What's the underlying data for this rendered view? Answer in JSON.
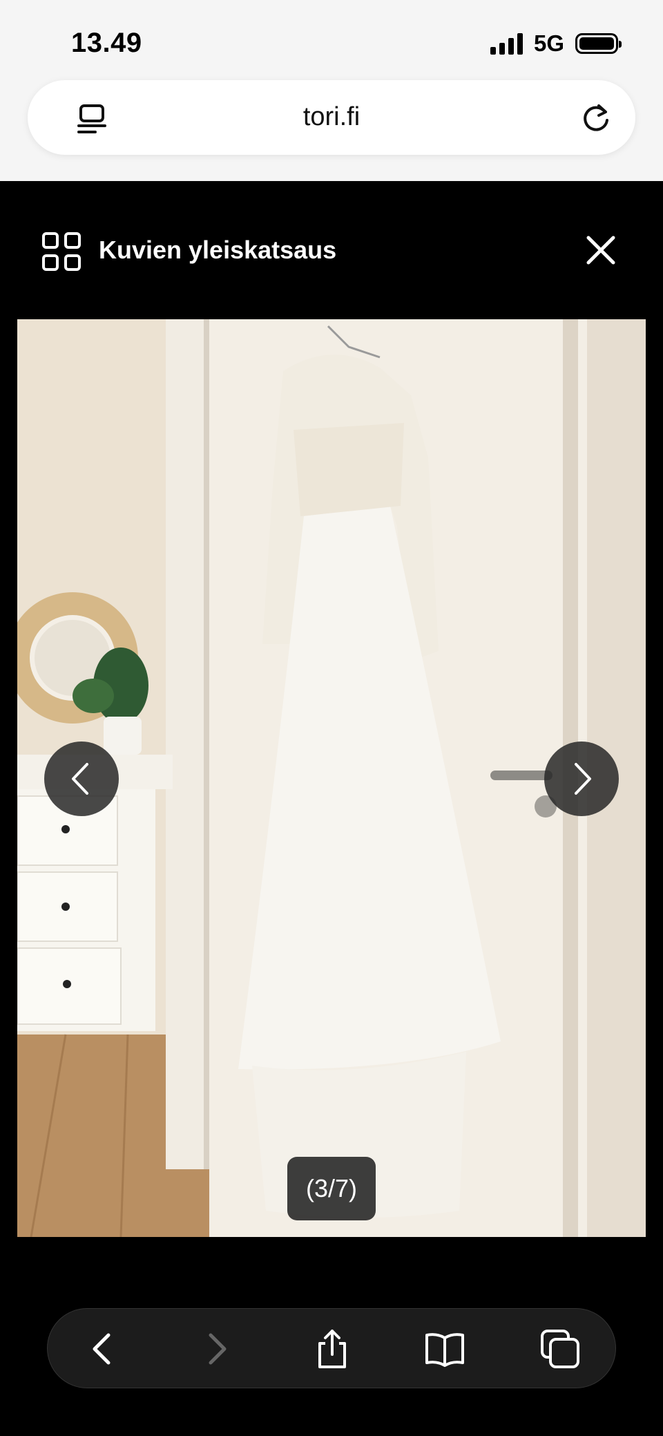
{
  "status_bar": {
    "time": "13.49",
    "network": "5G"
  },
  "browser": {
    "url": "tori.fi"
  },
  "viewer": {
    "overview_label": "Kuvien yleiskatsaus",
    "counter": "(3/7)",
    "photo_subject": "white lace long-sleeve wedding dress hanging on door"
  },
  "icons": {
    "reader": "reader-mode-icon",
    "reload": "reload-icon",
    "grid": "grid-icon",
    "close": "close-icon",
    "prev": "chevron-left-icon",
    "next": "chevron-right-icon",
    "back": "back-icon",
    "forward": "forward-icon",
    "share": "share-icon",
    "bookmarks": "bookmarks-icon",
    "tabs": "tabs-icon"
  },
  "colors": {
    "overlay_bg": "#000000",
    "toolbar_bg": "#1c1c1c",
    "status_bg": "#f5f5f5"
  }
}
